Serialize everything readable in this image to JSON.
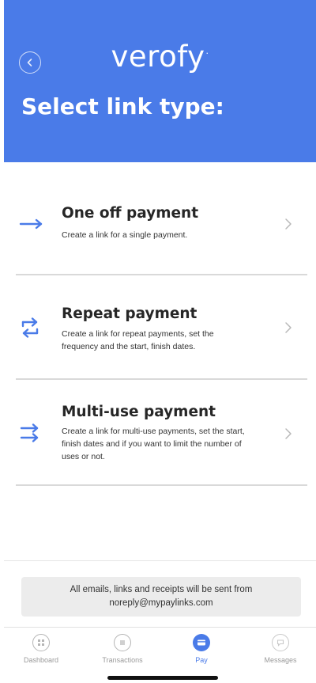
{
  "header": {
    "logo": "verofy",
    "logo_mark": "·",
    "title": "Select link type:",
    "back_icon": "chevron-left-circle-icon"
  },
  "options": [
    {
      "title": "One off payment",
      "description": "Create a link for a single payment.",
      "icon": "arrow-right-icon"
    },
    {
      "title": "Repeat payment",
      "description": "Create a link for repeat payments, set the frequency and the start, finish dates.",
      "icon": "repeat-arrows-icon"
    },
    {
      "title": "Multi-use payment",
      "description": "Create a link for multi-use payments, set the start, finish dates and if you want to limit the number of uses or not.",
      "icon": "double-arrow-right-icon"
    }
  ],
  "notice": {
    "line1": "All emails, links and receipts will be sent from",
    "line2": "noreply@mypaylinks.com"
  },
  "tabs": [
    {
      "label": "Dashboard",
      "icon": "dashboard-icon"
    },
    {
      "label": "Transactions",
      "icon": "transactions-icon"
    },
    {
      "label": "Pay",
      "icon": "pay-icon",
      "active": true
    },
    {
      "label": "Messages",
      "icon": "messages-icon"
    }
  ],
  "colors": {
    "brand": "#4a7be8",
    "chevron": "#b8b8b8",
    "divider": "#d9d9d9",
    "inactive_tab": "#9a9a9a"
  }
}
